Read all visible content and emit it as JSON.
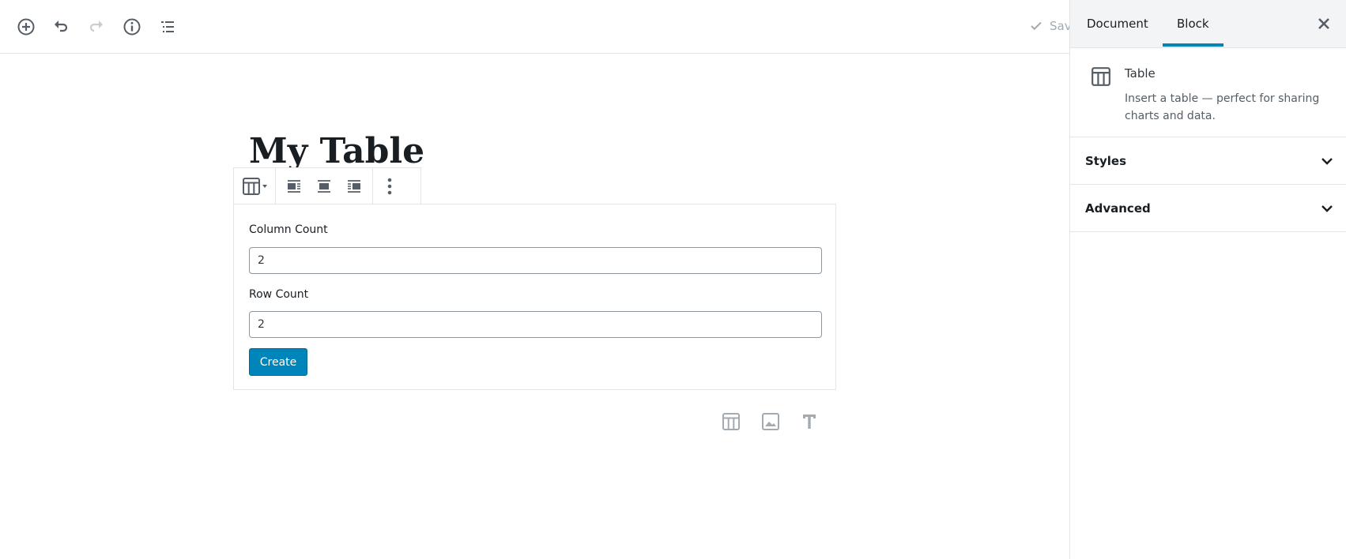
{
  "toolbar": {
    "save_label": "Saved",
    "icons": [
      "add-block-icon",
      "undo-icon",
      "redo-icon",
      "info-icon",
      "outline-icon"
    ]
  },
  "sidebar": {
    "tabs": [
      {
        "label": "Document",
        "active": false
      },
      {
        "label": "Block",
        "active": true
      }
    ],
    "block": {
      "name": "Table",
      "description": "Insert a table — perfect for sharing charts and data."
    },
    "panels": [
      {
        "label": "Styles"
      },
      {
        "label": "Advanced"
      }
    ]
  },
  "editor": {
    "title": "My Table",
    "table_placeholder": {
      "column_label": "Column Count",
      "column_value": "2",
      "row_label": "Row Count",
      "row_value": "2",
      "create_label": "Create"
    },
    "inserter_icons": [
      "table-icon",
      "image-icon",
      "text-icon"
    ]
  },
  "colors": {
    "accent": "#0085ba",
    "icon": "#555d66",
    "muted": "#a2aab2"
  }
}
